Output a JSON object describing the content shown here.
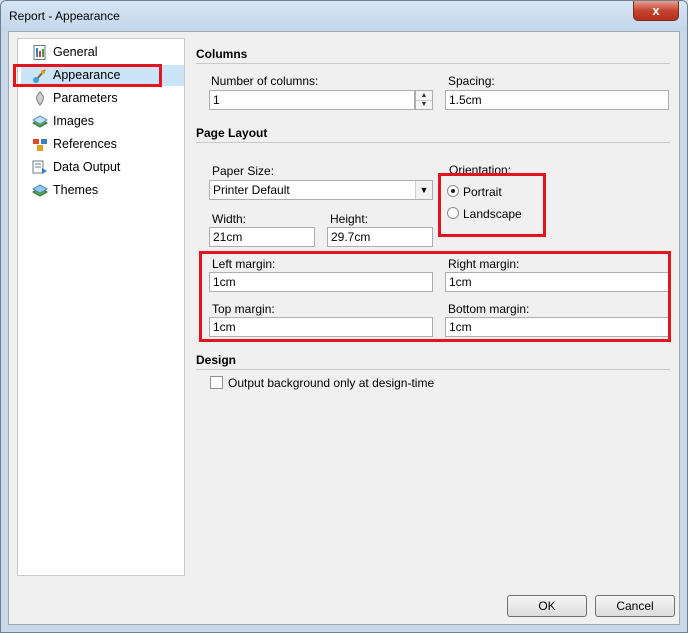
{
  "window": {
    "title": "Report - Appearance",
    "close_glyph": "x"
  },
  "sidebar": {
    "items": [
      {
        "label": "General",
        "icon": "report-icon"
      },
      {
        "label": "Appearance",
        "icon": "brush-icon",
        "selected": true
      },
      {
        "label": "Parameters",
        "icon": "parameters-icon"
      },
      {
        "label": "Images",
        "icon": "images-icon"
      },
      {
        "label": "References",
        "icon": "references-icon"
      },
      {
        "label": "Data Output",
        "icon": "data-output-icon"
      },
      {
        "label": "Themes",
        "icon": "themes-icon"
      }
    ]
  },
  "columns": {
    "section_title": "Columns",
    "number_label": "Number of columns:",
    "number_value": "1",
    "spacing_label": "Spacing:",
    "spacing_value": "1.5cm"
  },
  "page_layout": {
    "section_title": "Page Layout",
    "paper_size_label": "Paper Size:",
    "paper_size_value": "Printer Default",
    "width_label": "Width:",
    "width_value": "21cm",
    "height_label": "Height:",
    "height_value": "29.7cm",
    "orientation_label": "Orientation:",
    "portrait_label": "Portrait",
    "landscape_label": "Landscape",
    "orientation_selected": "Portrait",
    "left_margin_label": "Left margin:",
    "left_margin_value": "1cm",
    "right_margin_label": "Right margin:",
    "right_margin_value": "1cm",
    "top_margin_label": "Top margin:",
    "top_margin_value": "1cm",
    "bottom_margin_label": "Bottom margin:",
    "bottom_margin_value": "1cm"
  },
  "design": {
    "section_title": "Design",
    "background_checkbox_label": "Output background only at design-time",
    "background_checked": false
  },
  "footer": {
    "ok_label": "OK",
    "cancel_label": "Cancel"
  },
  "colors": {
    "highlight": "#e3141f",
    "selection": "#cce4f7"
  }
}
